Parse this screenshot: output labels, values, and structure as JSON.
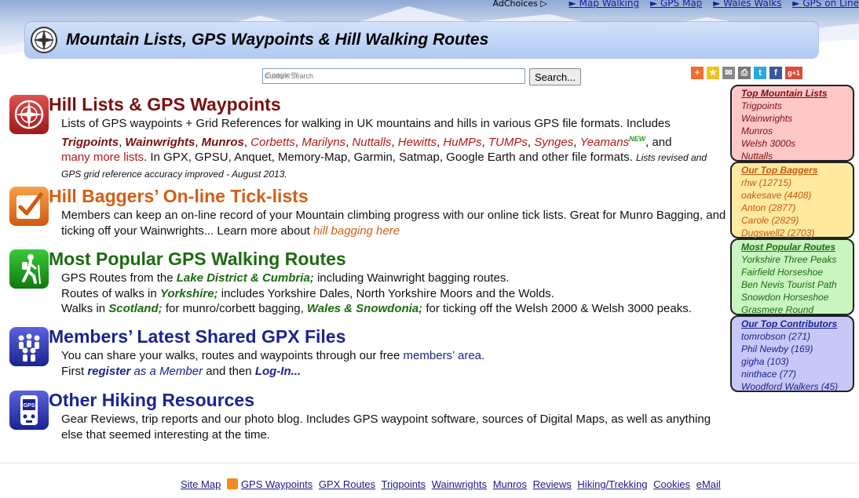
{
  "adbar": {
    "adchoices": "AdChoices ▷",
    "links": [
      "► Map Walking",
      "► GPS Map",
      "► Wales Walks",
      "► GPS on Line"
    ]
  },
  "header": {
    "title": "Mountain Lists, GPS Waypoints & Hill Walking Routes"
  },
  "search": {
    "placeholder": "Custom Search",
    "brand": "Google™",
    "button": "Search..."
  },
  "share_icons": [
    "addthis-icon",
    "favorite-icon",
    "email-icon",
    "print-icon",
    "twitter-icon",
    "facebook-icon",
    "google-plus-icon"
  ],
  "share_labels": {
    "addthis": "+",
    "favorite": "★",
    "email": "✉",
    "print": "⎙",
    "twitter": "t",
    "facebook": "f",
    "google_plus": "g+1"
  },
  "sections": {
    "hill_lists": {
      "title": "Hill Lists & GPS Waypoints",
      "color": "#7a1010",
      "t1": "Lists of GPS waypoints + Grid References for walking in UK mountains and hills in various GPS file formats. Includes",
      "l_trig": "Trigpoints",
      "l_wain": "Wainwrights",
      "l_mun": "Munros",
      "l_corb": "Corbetts",
      "l_mar": "Marilyns",
      "l_nut": "Nuttalls",
      "l_hew": "Hewitts",
      "l_hump": "HuMPs",
      "l_tump": "TUMPs",
      "l_syn": "Synges",
      "l_yea": "Yeamans",
      "new": "NEW",
      "and": ", and",
      "l_more": "many more lists",
      "t2": ". In GPX, GPSU, Anquet, Memory-Map, Garmin, Satmap, Google Earth and other file formats.",
      "t3": "Lists revised and GPS grid reference accuracy improved - August 2013."
    },
    "baggers": {
      "title": "Hill Baggers’ On-line Tick-lists",
      "color": "#d35f16",
      "t1": "Members can keep an on-line record of your Mountain climbing progress with our online tick lists. Great for Munro Bagging, and ticking off your Wainwrights... Learn more about",
      "link": "hill bagging here"
    },
    "routes": {
      "title": "Most Popular GPS Walking Routes",
      "color": "#1c6b12",
      "r1a": "GPS Routes from the",
      "r1l": "Lake District & Cumbria;",
      "r1b": "including Wainwright bagging routes.",
      "r2a": "Routes of walks in",
      "r2l": "Yorkshire;",
      "r2b": "includes Yorkshire Dales, North Yorkshire Moors and the Wolds.",
      "r3a": "Walks in",
      "r3l": "Scotland;",
      "r3b": "for munro/corbett bagging,",
      "r3l2": "Wales & Snowdonia;",
      "r3c": "for ticking off the Welsh 2000 & Welsh 3000 peaks."
    },
    "shared": {
      "title": "Members’ Latest Shared GPX Files",
      "color": "#1a2490",
      "t1": "You can share your walks, routes and waypoints through our free",
      "l1": "members’ area.",
      "t2": "First",
      "l2": "register",
      "l3": "as a Member",
      "t3": "and then",
      "l4": "Log-In..."
    },
    "other": {
      "title": "Other Hiking Resources",
      "color": "#1a2490",
      "t1": "Gear Reviews, trip reports and our photo blog. Includes GPS waypoint software, sources of Digital Maps, as well as anything else that seemed interesting at the time.",
      "gps_label": "GPS"
    }
  },
  "sidebar": {
    "top_lists": {
      "heading": "Top Mountain Lists",
      "items": [
        "Trigpoints",
        "Wainwrights",
        "Munros",
        "Welsh 3000s",
        "Nuttalls"
      ],
      "bg": "#ffc8c8",
      "color": "#7a1010"
    },
    "baggers": {
      "heading": "Our Top Baggers",
      "items": [
        "rhw (12715)",
        "oakesave (4408)",
        "Anton (2877)",
        "Carole (2829)",
        "Dugswell2 (2703)"
      ],
      "bg": "#ffeaa0",
      "color": "#c45a10"
    },
    "routes": {
      "heading": "Most Popular Routes",
      "items": [
        "Yorkshire Three Peaks",
        "Fairfield Horseshoe",
        "Ben Nevis Tourist Path",
        "Snowdon Horseshoe",
        "Grasmere Round"
      ],
      "bg": "#c8f5c0",
      "color": "#1c6b12"
    },
    "contributors": {
      "heading": "Our Top Contributors",
      "items": [
        "tomrobson (271)",
        "Phil Newby (169)",
        "gigha (103)",
        "ninthace (77)",
        "Woodford Walkers (45)"
      ],
      "bg": "#c8c8f8",
      "color": "#1a2490"
    }
  },
  "footer": {
    "links": [
      "Site Map",
      "GPS Waypoints",
      "GPX Routes",
      "Trigpoints",
      "Wainwrights",
      "Munros",
      "Reviews",
      "Hiking/Trekking",
      "Cookies",
      "eMail"
    ]
  }
}
